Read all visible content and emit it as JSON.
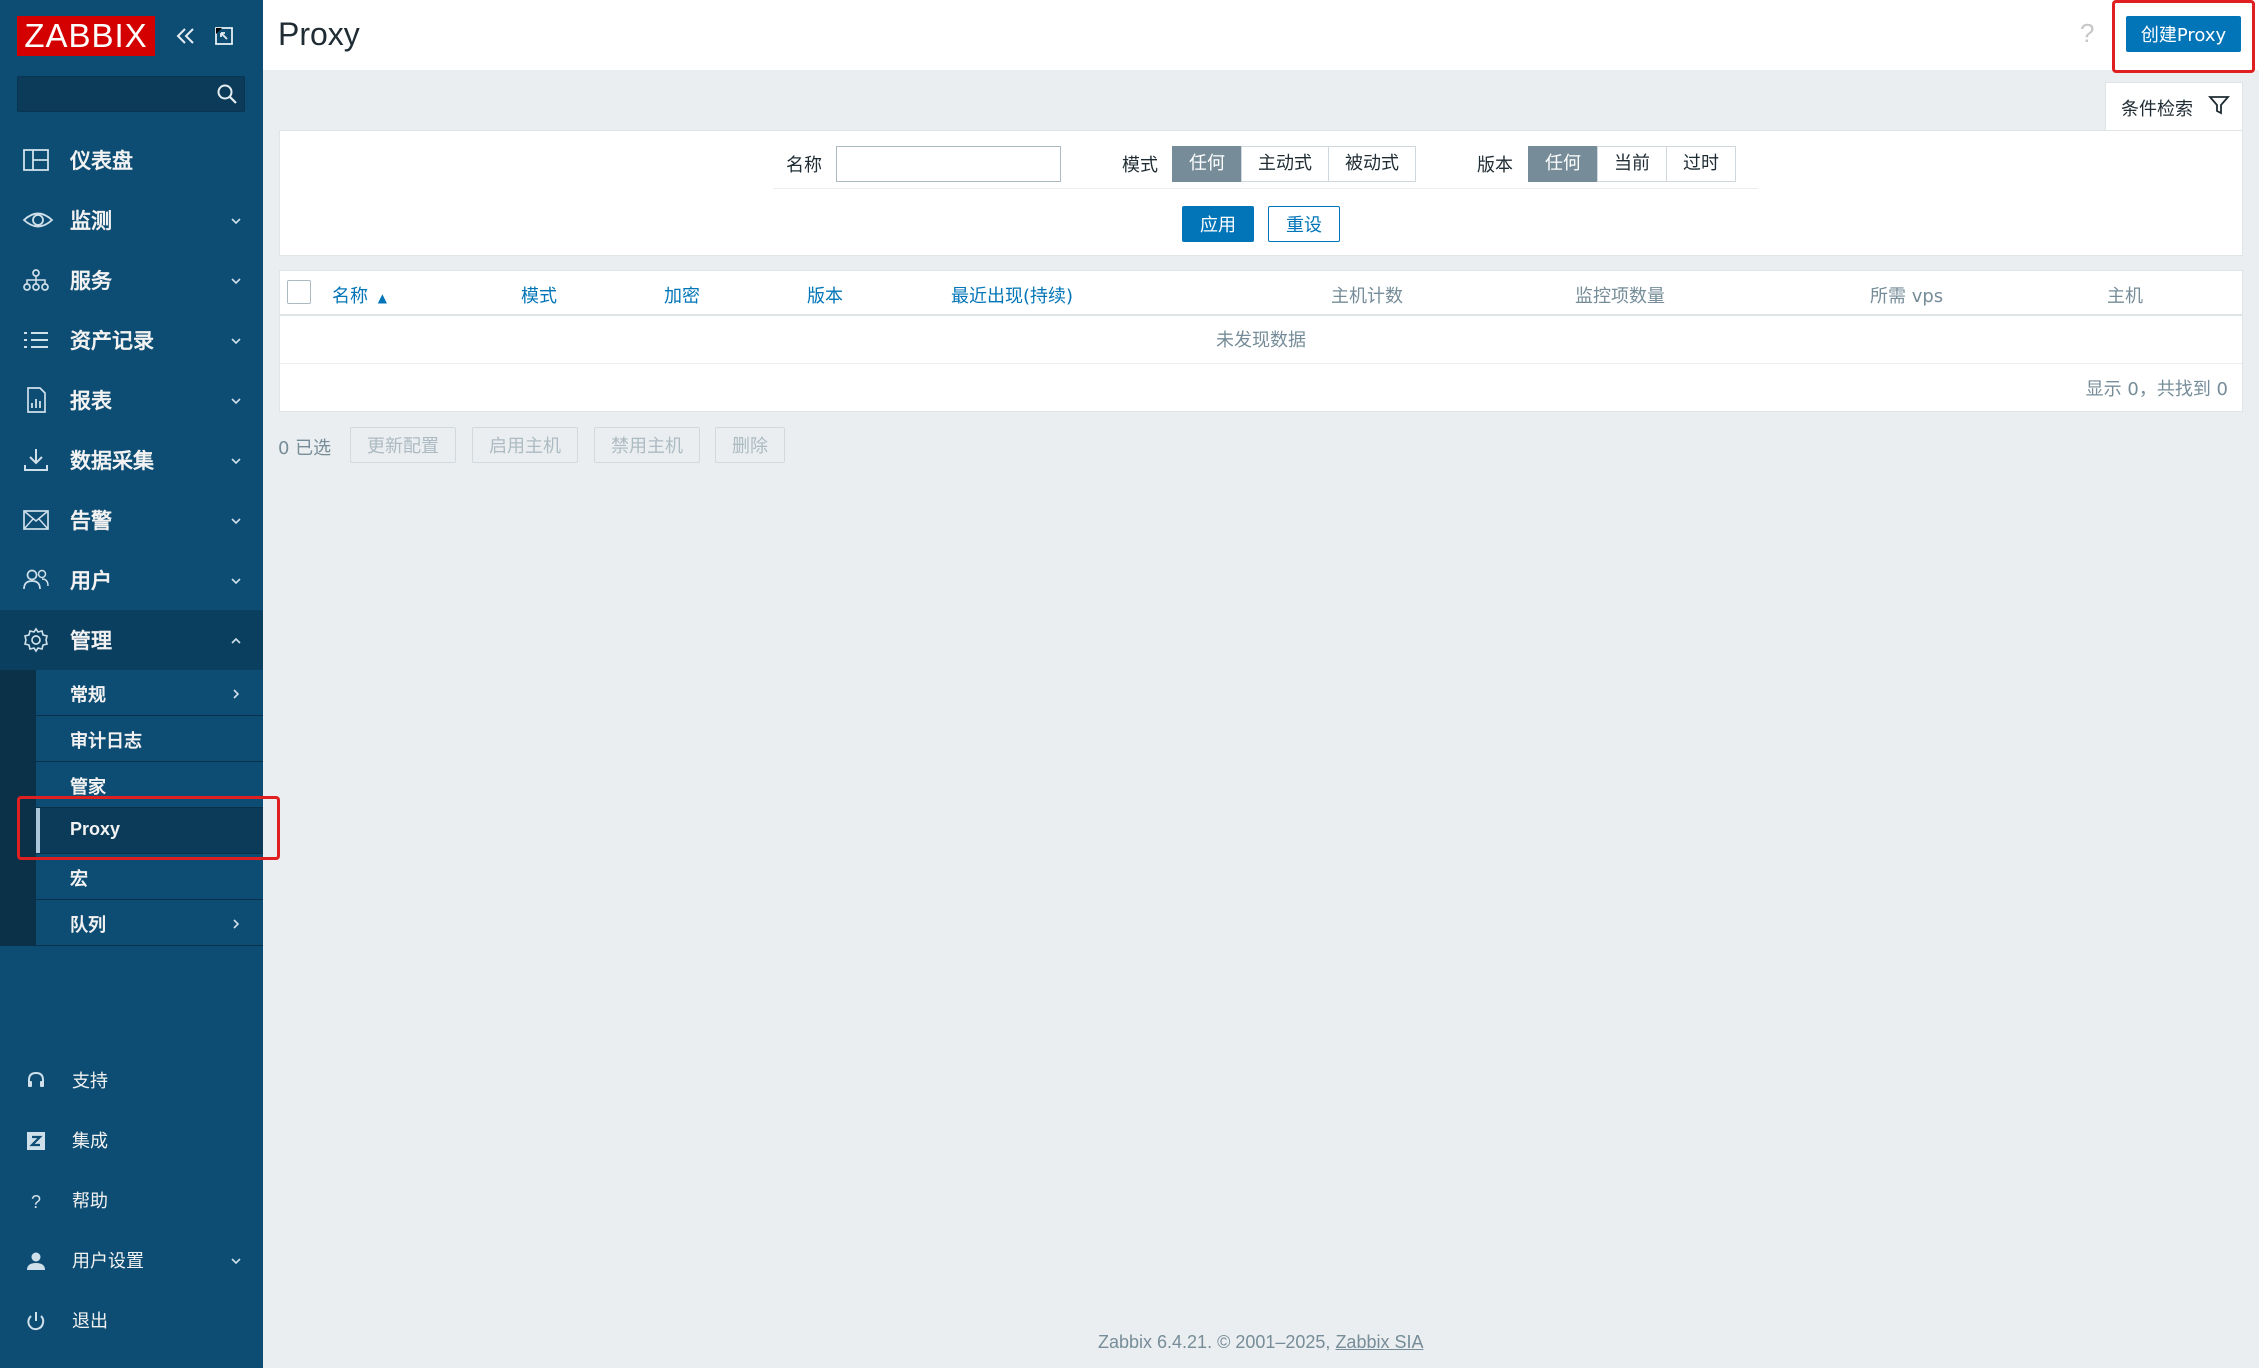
{
  "app": {
    "logo_text": "ZABBIX",
    "brand_color": "#d40000"
  },
  "search": {
    "placeholder": "",
    "value": ""
  },
  "sidebar": {
    "items": [
      {
        "label": "仪表盘",
        "icon": "dashboard-icon",
        "expandable": false
      },
      {
        "label": "监测",
        "icon": "eye-icon",
        "expandable": true
      },
      {
        "label": "服务",
        "icon": "services-icon",
        "expandable": true
      },
      {
        "label": "资产记录",
        "icon": "list-icon",
        "expandable": true
      },
      {
        "label": "报表",
        "icon": "report-icon",
        "expandable": true
      },
      {
        "label": "数据采集",
        "icon": "download-icon",
        "expandable": true
      },
      {
        "label": "告警",
        "icon": "envelope-icon",
        "expandable": true
      },
      {
        "label": "用户",
        "icon": "users-icon",
        "expandable": true
      },
      {
        "label": "管理",
        "icon": "gear-icon",
        "expandable": true,
        "expanded": true
      }
    ],
    "admin_submenu": [
      {
        "label": "常规",
        "has_children": true
      },
      {
        "label": "审计日志",
        "has_children": false
      },
      {
        "label": "管家",
        "has_children": false
      },
      {
        "label": "Proxy",
        "has_children": false,
        "selected": true
      },
      {
        "label": "宏",
        "has_children": false
      },
      {
        "label": "队列",
        "has_children": true
      }
    ],
    "bottom": [
      {
        "label": "支持",
        "icon": "headset-icon"
      },
      {
        "label": "集成",
        "icon": "zabbix-z-icon"
      },
      {
        "label": "帮助",
        "icon": "question-icon"
      },
      {
        "label": "用户设置",
        "icon": "user-icon",
        "expandable": true
      },
      {
        "label": "退出",
        "icon": "power-icon"
      }
    ]
  },
  "header": {
    "title": "Proxy",
    "help": "?",
    "create_label": "创建Proxy"
  },
  "filter": {
    "tab_label": "条件检索",
    "name_label": "名称",
    "name_value": "",
    "mode_label": "模式",
    "mode_options": [
      "任何",
      "主动式",
      "被动式"
    ],
    "mode_selected": "任何",
    "version_label": "版本",
    "version_options": [
      "任何",
      "当前",
      "过时"
    ],
    "version_selected": "任何",
    "apply_label": "应用",
    "reset_label": "重设"
  },
  "table": {
    "columns": [
      "名称",
      "模式",
      "加密",
      "版本",
      "最近出现(持续)",
      "主机计数",
      "监控项数量",
      "所需 vps",
      "主机"
    ],
    "sort_indicator": "▲",
    "empty_text": "未发现数据",
    "paging_text": "显示 0，共找到 0"
  },
  "actions": {
    "selected_text": "0 已选",
    "buttons": [
      "更新配置",
      "启用主机",
      "禁用主机",
      "删除"
    ]
  },
  "footer": {
    "text": "Zabbix 6.4.21. © 2001–2025, ",
    "link": "Zabbix SIA"
  },
  "colors": {
    "sidebar_bg": "#0e4d73",
    "accent": "#0275b8",
    "highlight_box": "#e02020",
    "toggle_on": "#768d99"
  }
}
